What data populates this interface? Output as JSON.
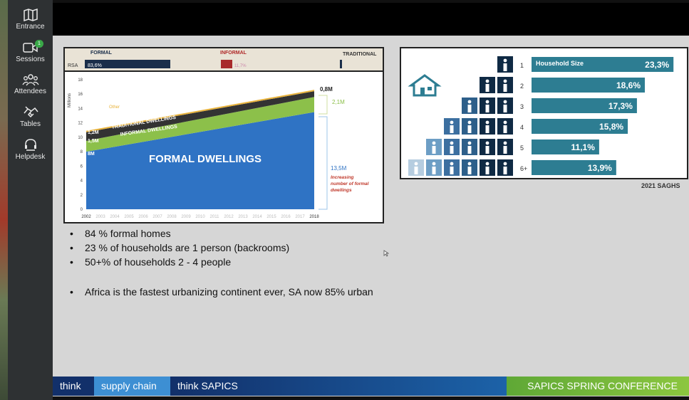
{
  "sidebar": {
    "items": [
      {
        "label": "Entrance"
      },
      {
        "label": "Sessions",
        "badge": "1"
      },
      {
        "label": "Attendees"
      },
      {
        "label": "Tables"
      },
      {
        "label": "Helpdesk"
      }
    ]
  },
  "slide": {
    "left_chart": {
      "bar_headers": {
        "formal": "FORMAL",
        "informal": "INFORMAL",
        "traditional": "TRADITIONAL"
      },
      "rsa_label": "RSA",
      "formal_pct": "83,6%",
      "informal_pct": "11,7%",
      "start_labels": {
        "top": "1,2M",
        "mid": "1,5M",
        "base": "8M",
        "other": "Other"
      },
      "end_labels": {
        "top": "0,8M",
        "mid": "2,1M",
        "base": "13,5M"
      },
      "band_labels": {
        "traditional": "TRADITIONAL DWELLINGS",
        "informal": "INFORMAL DWELLINGS",
        "formal": "FORMAL DWELLINGS"
      },
      "note": [
        "Increasing",
        "number of formal",
        "dwellings"
      ]
    },
    "right_chart": {
      "title": "Household Size",
      "source": "2021 SAGHS"
    },
    "bullets": [
      "84 % formal homes",
      "23 % of households are 1 person (backrooms)",
      "50+% of households 2 - 4 people",
      "Africa is the fastest urbanizing continent ever, SA now 85% urban"
    ],
    "bullet_char": "•"
  },
  "banner": {
    "think": "think",
    "supply_chain": "supply chain",
    "think_sapics": "think SAPICS",
    "conference": "SAPICS SPRING CONFERENCE"
  },
  "chart_data": [
    {
      "type": "area",
      "x": [
        2002,
        2018
      ],
      "series": [
        {
          "name": "FORMAL DWELLINGS",
          "values": [
            8,
            13.5
          ],
          "unit": "M"
        },
        {
          "name": "INFORMAL DWELLINGS",
          "values": [
            1.5,
            2.1
          ],
          "unit": "M"
        },
        {
          "name": "TRADITIONAL DWELLINGS",
          "values": [
            1.2,
            0.8
          ],
          "unit": "M"
        },
        {
          "name": "Other",
          "values": [
            0.2,
            0.2
          ],
          "unit": "M"
        }
      ],
      "ylabel": "Millions",
      "ylim": [
        0,
        18
      ],
      "yticks": [
        0,
        2,
        4,
        6,
        8,
        10,
        12,
        14,
        16,
        18
      ],
      "xticks": [
        "2002",
        "2003",
        "2004",
        "2005",
        "2006",
        "2007",
        "2008",
        "2009",
        "2010",
        "2011",
        "2012",
        "2013",
        "2014",
        "2015",
        "2016",
        "2017",
        "2018"
      ]
    },
    {
      "type": "bar",
      "title": "Household Size",
      "categories": [
        "1",
        "2",
        "3",
        "4",
        "5",
        "6+"
      ],
      "values": [
        23.3,
        18.6,
        17.3,
        15.8,
        11.1,
        13.9
      ],
      "labels": [
        "23,3%",
        "18,6%",
        "17,3%",
        "15,8%",
        "11,1%",
        "13,9%"
      ],
      "bar_color": "#2d7d92"
    }
  ]
}
